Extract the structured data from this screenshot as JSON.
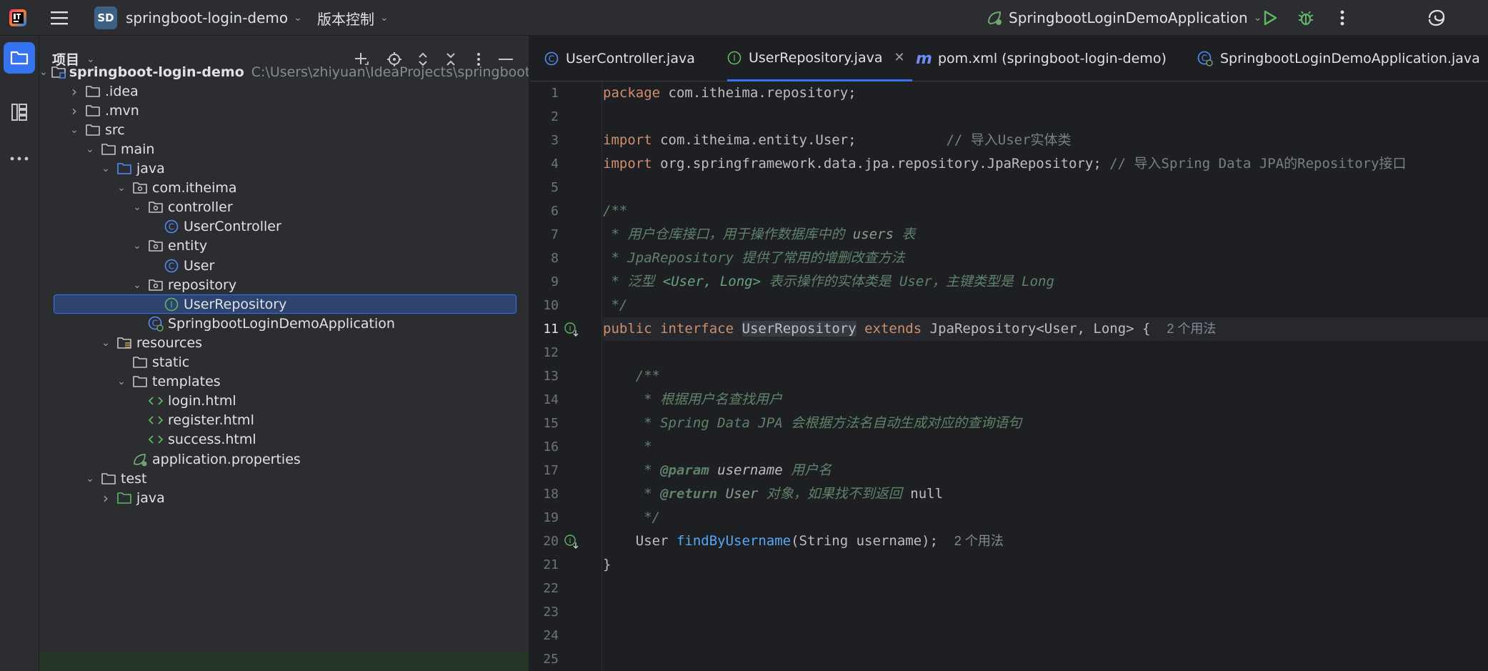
{
  "topbar": {
    "project_badge": "SD",
    "project_name": "springboot-login-demo",
    "vcs_label": "版本控制",
    "run_config": "SpringbootLoginDemoApplication"
  },
  "panel": {
    "title": "项目"
  },
  "tree": [
    {
      "label": "springboot-login-demo",
      "path": "C:\\Users\\zhiyuan\\IdeaProjects\\springboot-lo",
      "icon": "module-folder-icon",
      "depth": 0,
      "expanded": true
    },
    {
      "label": ".idea",
      "icon": "folder-icon",
      "depth": 1,
      "expanded": false
    },
    {
      "label": ".mvn",
      "icon": "folder-icon",
      "depth": 1,
      "expanded": false
    },
    {
      "label": "src",
      "icon": "folder-icon",
      "depth": 1,
      "expanded": true
    },
    {
      "label": "main",
      "icon": "folder-icon",
      "depth": 2,
      "expanded": true
    },
    {
      "label": "java",
      "icon": "source-folder-icon",
      "depth": 3,
      "expanded": true
    },
    {
      "label": "com.itheima",
      "icon": "package-icon",
      "depth": 4,
      "expanded": true
    },
    {
      "label": "controller",
      "icon": "package-icon",
      "depth": 5,
      "expanded": true
    },
    {
      "label": "UserController",
      "icon": "class-icon",
      "depth": 6
    },
    {
      "label": "entity",
      "icon": "package-icon",
      "depth": 5,
      "expanded": true
    },
    {
      "label": "User",
      "icon": "class-icon",
      "depth": 6
    },
    {
      "label": "repository",
      "icon": "package-icon",
      "depth": 5,
      "expanded": true
    },
    {
      "label": "UserRepository",
      "icon": "interface-icon",
      "depth": 6,
      "selected": true
    },
    {
      "label": "SpringbootLoginDemoApplication",
      "icon": "spring-class-icon",
      "depth": 5
    },
    {
      "label": "resources",
      "icon": "resources-folder-icon",
      "depth": 3,
      "expanded": true
    },
    {
      "label": "static",
      "icon": "folder-icon",
      "depth": 4
    },
    {
      "label": "templates",
      "icon": "folder-icon",
      "depth": 4,
      "expanded": true
    },
    {
      "label": "login.html",
      "icon": "html-icon",
      "depth": 5
    },
    {
      "label": "register.html",
      "icon": "html-icon",
      "depth": 5
    },
    {
      "label": "success.html",
      "icon": "html-icon",
      "depth": 5
    },
    {
      "label": "application.properties",
      "icon": "spring-properties-icon",
      "depth": 4
    },
    {
      "label": "test",
      "icon": "folder-icon",
      "depth": 2,
      "expanded": true
    },
    {
      "label": "java",
      "icon": "test-folder-icon",
      "depth": 3,
      "expanded": false
    }
  ],
  "tabs": [
    {
      "label": "UserController.java",
      "icon": "class-icon"
    },
    {
      "label": "UserRepository.java",
      "icon": "interface-icon",
      "active": true
    },
    {
      "label": "pom.xml (springboot-login-demo)",
      "icon": "maven-icon"
    },
    {
      "label": "SpringbootLoginDemoApplication.java",
      "icon": "spring-class-icon"
    }
  ],
  "editor": {
    "line_numbers": [
      "1",
      "2",
      "3",
      "4",
      "5",
      "6",
      "7",
      "8",
      "9",
      "10",
      "11",
      "12",
      "13",
      "14",
      "15",
      "16",
      "17",
      "18",
      "19",
      "20",
      "21",
      "22",
      "23",
      "24",
      "25"
    ],
    "code": {
      "l1_kw": "package",
      "l1_rest": " com.itheima.repository;",
      "l3_kw": "import",
      "l3_rest": " com.itheima.entity.User;           ",
      "l3_cm": "// 导入User实体类",
      "l4_kw": "import",
      "l4_rest": " org.springframework.data.jpa.repository.JpaRepository; ",
      "l4_cm": "// 导入Spring Data JPA的Repository接口",
      "l6": "/**",
      "l7_a": " * 用户仓库接口，用于操作数据库中的 ",
      "l7_b": "users",
      "l7_c": " 表",
      "l8_a": " * ",
      "l8_b": "JpaRepository",
      "l8_c": " 提供了常用的增删改查方法",
      "l9_a": " * 泛型 ",
      "l9_b": "<User, Long>",
      "l9_c": " 表示操作的实体类是 ",
      "l9_d": "User",
      "l9_e": "，主键类型是 ",
      "l9_f": "Long",
      "l10": " */",
      "l11_kw1": "public",
      "l11_kw2": "interface",
      "l11_name": "UserRepository",
      "l11_kw3": "extends",
      "l11_rest": " JpaRepository<User, Long> {",
      "l11_hint": "2 个用法",
      "l13": "    /**",
      "l14": "     * 根据用户名查找用户",
      "l15_a": "     * ",
      "l15_b": "Spring Data JPA",
      "l15_c": " 会根据方法名自动生成对应的查询语句",
      "l16": "     *",
      "l17_a": "     * ",
      "l17_b": "@param",
      "l17_c": " username",
      "l17_d": " 用户名",
      "l18_a": "     * ",
      "l18_b": "@return",
      "l18_c": " User",
      "l18_d": " 对象，如果找不到返回 ",
      "l18_e": "null",
      "l19": "     */",
      "l20_a": "    User ",
      "l20_fn": "findByUsername",
      "l20_b": "(String username);",
      "l20_hint": "2 个用法",
      "l21": "}"
    }
  },
  "colors": {
    "accent": "#3574f0",
    "keyword": "#cf8e6d",
    "doc_comment": "#5f826b",
    "function": "#56a8f5"
  }
}
